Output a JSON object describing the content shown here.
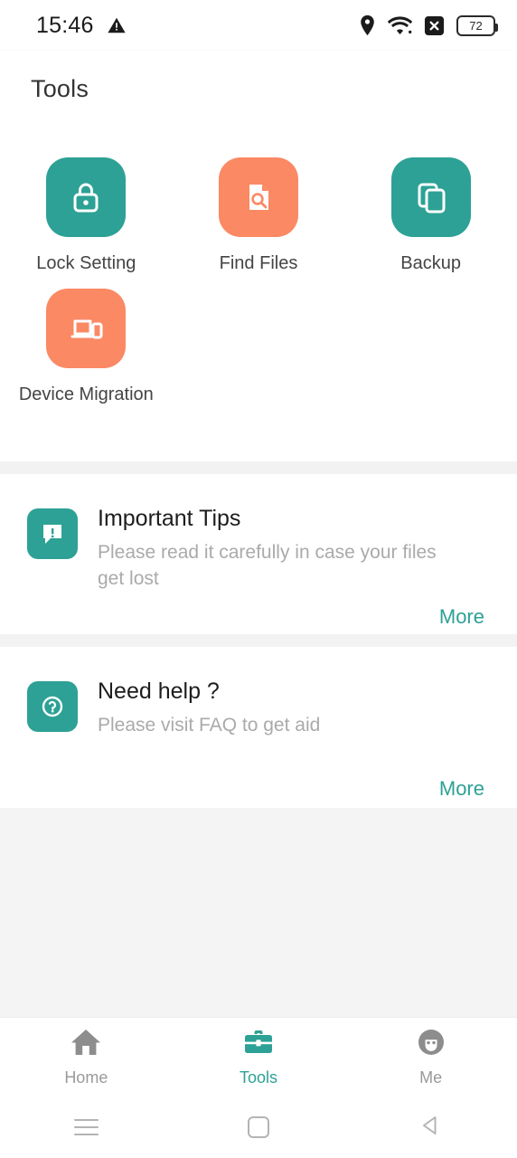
{
  "status_bar": {
    "time": "15:46",
    "warning_icon": "warning-triangle-icon",
    "icons": [
      "location-pin-icon",
      "wifi-icon",
      "no-sim-icon"
    ],
    "battery_level": "72"
  },
  "header": {
    "title": "Tools"
  },
  "tools": [
    {
      "label": "Lock Setting",
      "icon": "lock-icon",
      "color": "#2da195"
    },
    {
      "label": "Find Files",
      "icon": "file-search-icon",
      "color": "#fa8964"
    },
    {
      "label": "Backup",
      "icon": "copy-icon",
      "color": "#2da195"
    },
    {
      "label": "Device Migration",
      "icon": "devices-transfer-icon",
      "color": "#fa8964"
    }
  ],
  "cards": [
    {
      "title": "Important Tips",
      "description": "Please read it carefully in case your files get lost",
      "icon": "chat-alert-icon",
      "action": "More"
    },
    {
      "title": "Need help ?",
      "description": "Please visit FAQ to get aid",
      "icon": "help-circle-icon",
      "action": "More"
    }
  ],
  "bottom_nav": [
    {
      "label": "Home",
      "icon": "home-icon",
      "active": false
    },
    {
      "label": "Tools",
      "icon": "briefcase-icon",
      "active": true
    },
    {
      "label": "Me",
      "icon": "avatar-icon",
      "active": false
    }
  ],
  "system_nav": [
    {
      "name": "recents-button"
    },
    {
      "name": "home-button"
    },
    {
      "name": "back-button"
    }
  ],
  "theme": {
    "accent": "#2da195",
    "secondary": "#fa8964",
    "background": "#f4f4f4",
    "surface": "#ffffff",
    "muted_text": "#aaaaaa"
  }
}
